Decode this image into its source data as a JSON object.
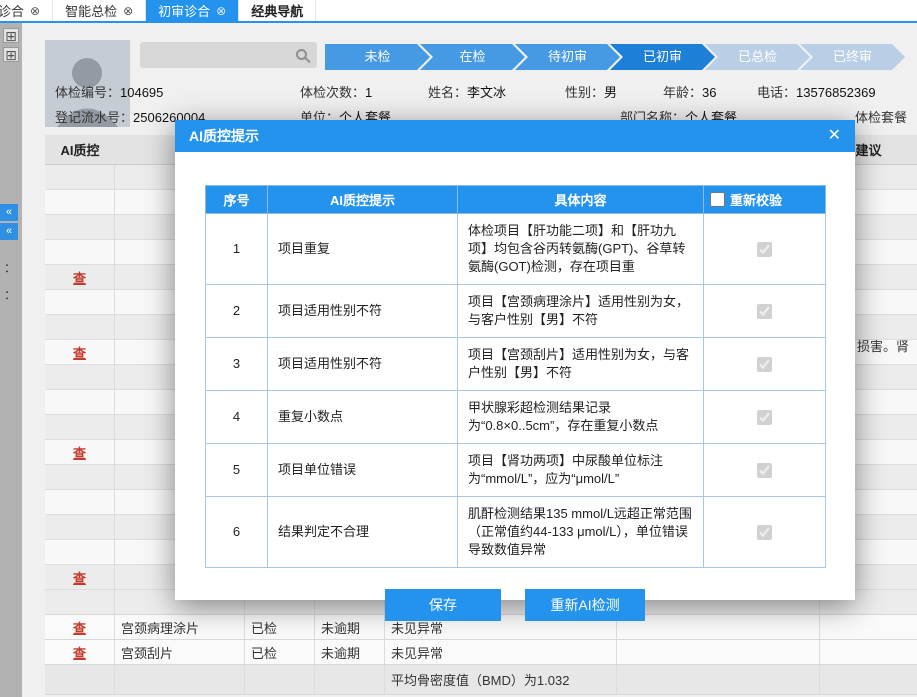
{
  "tabbar": {
    "close_glyph": "⊗",
    "tabs": [
      {
        "label": "诊合"
      },
      {
        "label": "智能总检"
      },
      {
        "label": "初审诊合"
      },
      {
        "label": "经典导航"
      }
    ]
  },
  "left_panel": {
    "panel_icon": "⊞",
    "collapse_glyph": "«",
    "colon": "："
  },
  "search": {
    "placeholder": ""
  },
  "workflow": [
    {
      "label": "未检"
    },
    {
      "label": "在检"
    },
    {
      "label": "待初审"
    },
    {
      "label": "已初审"
    },
    {
      "label": "已总检"
    },
    {
      "label": "已终审"
    }
  ],
  "patient": {
    "row1": [
      {
        "label": "体检编号：",
        "value": "104695"
      },
      {
        "label": "体检次数：",
        "value": "1"
      },
      {
        "label": "姓名：",
        "value": "李文冰"
      },
      {
        "label": "性别：",
        "value": "男"
      },
      {
        "label": "年龄：",
        "value": "36"
      },
      {
        "label": "电话：",
        "value": "13576852369"
      }
    ],
    "row2": [
      {
        "label": "登记流水号：",
        "value": "2506260004"
      },
      {
        "label": "单位：",
        "value": "个人套餐"
      },
      {
        "label": "部门名称：",
        "value": "个人套餐"
      },
      {
        "label": "体检套餐",
        "value": ""
      }
    ]
  },
  "bg_table": {
    "header_left": "AI质控",
    "header_right": "建议",
    "row_icon": "查",
    "stripes": [
      0,
      0,
      0,
      0,
      1,
      0,
      0,
      1,
      0,
      0,
      0,
      1,
      0,
      0,
      0,
      0,
      1
    ],
    "rows": [
      {
        "item": "宫颈病理涂片",
        "status": "已检",
        "due": "未逾期",
        "result": "未见异常"
      },
      {
        "item": "宫颈刮片",
        "status": "已检",
        "due": "未逾期",
        "result": "未见异常"
      },
      {
        "item": "",
        "status": "",
        "due": "",
        "result": "平均骨密度值（BMD）为1.032"
      }
    ],
    "right_fragment": "损害。肾"
  },
  "modal": {
    "title": "AI质控提示",
    "close_glyph": "✕",
    "table": {
      "headers": [
        "序号",
        "AI质控提示",
        "具体内容",
        "重新校验"
      ],
      "recheck_all_checked": false,
      "rows": [
        {
          "no": "1",
          "tip": "项目重复",
          "detail": "体检项目【肝功能二项】和【肝功九项】均包含谷丙转氨酶(GPT)、谷草转氨酶(GOT)检测，存在项目重",
          "checked": true
        },
        {
          "no": "2",
          "tip": "项目适用性别不符",
          "detail": "项目【宫颈病理涂片】适用性别为女，与客户性别【男】不符",
          "checked": true
        },
        {
          "no": "3",
          "tip": "项目适用性别不符",
          "detail": "项目【宫颈刮片】适用性别为女，与客户性别【男】不符",
          "checked": true
        },
        {
          "no": "4",
          "tip": "重复小数点",
          "detail": "甲状腺彩超检测结果记录为“0.8×0..5cm”，存在重复小数点",
          "checked": true
        },
        {
          "no": "5",
          "tip": "项目单位错误",
          "detail": "项目【肾功两项】中尿酸单位标注为“mmol/L”，应为“μmol/L”",
          "checked": true
        },
        {
          "no": "6",
          "tip": "结果判定不合理",
          "detail": "肌酐检测结果135 mmol/L远超正常范围（正常值约44-133 μmol/L），单位错误导致数值异常",
          "checked": true
        }
      ]
    },
    "buttons": {
      "save": "保存",
      "recheck": "重新AI检测"
    }
  },
  "colors": {
    "primary": "#2493ee",
    "alert_red": "#c53b2d"
  }
}
